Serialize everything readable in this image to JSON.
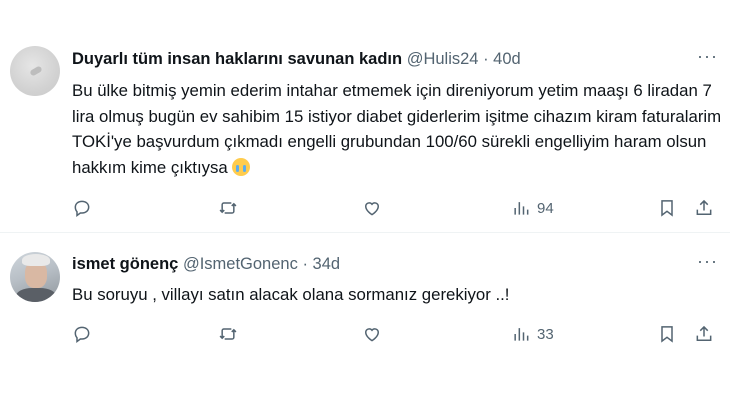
{
  "tweets": [
    {
      "name": "Duyarlı tüm insan haklarını savunan kadın",
      "handle": "@Hulis24",
      "dot": "·",
      "time": "40d",
      "more": "···",
      "text": "Bu ülke bitmiş yemin ederim intahar etmemek için direniyorum yetim maaşı 6 liradan 7 lira olmuş bugün ev sahibim 15 istiyor diabet giderlerim işitme cihazım kiram faturalarim TOKİ'ye başvurdum çıkmadı engelli grubundan 100/60 sürekli engelliyim haram olsun hakkım kime çıktıysa",
      "emoji": "loudly-crying-face-emoji",
      "views": "94"
    },
    {
      "name": "ismet gönenç",
      "handle": "@IsmetGonenc",
      "dot": "·",
      "time": "34d",
      "more": "···",
      "text": "Bu soruyu , villayı satın alacak olana sormanız gerekiyor ..!",
      "views": "33"
    }
  ],
  "icons": {
    "reply": "reply-icon",
    "retweet": "retweet-icon",
    "like": "like-icon",
    "views": "views-icon",
    "bookmark": "bookmark-icon",
    "share": "share-icon",
    "more": "more-icon"
  },
  "colors": {
    "text": "#0f1419",
    "secondary": "#536471",
    "divider": "#eff3f4"
  }
}
